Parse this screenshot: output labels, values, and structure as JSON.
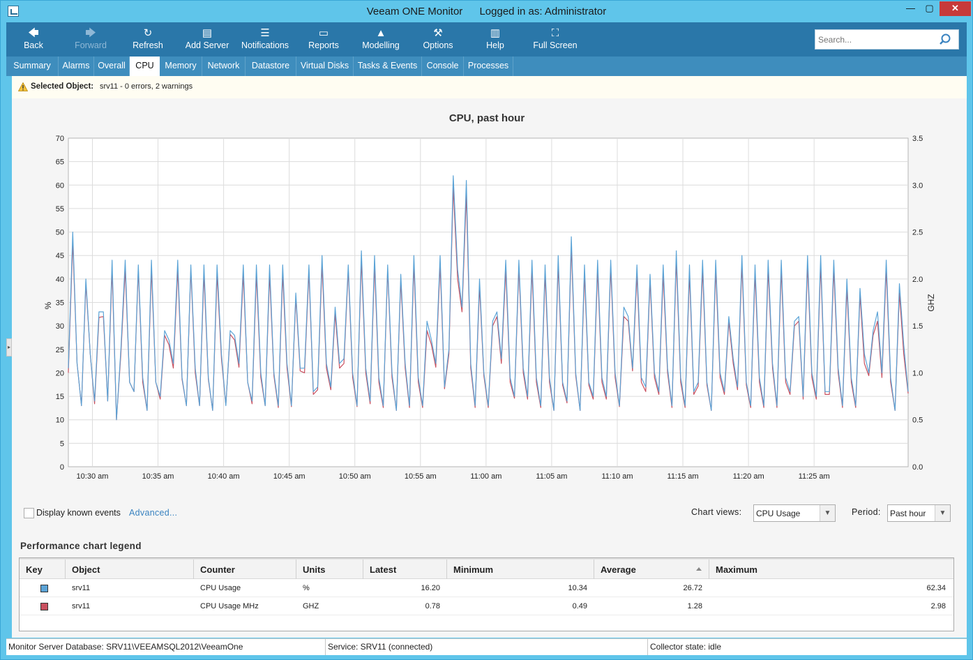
{
  "window": {
    "app_name": "Veeam ONE Monitor",
    "logged_in": "Logged in as: Administrator",
    "min_glyph": "—",
    "max_glyph": "▢",
    "close_glyph": "✕"
  },
  "toolbar": {
    "items": [
      {
        "label": "Back",
        "icon": "arrow-left-icon",
        "glyph": "🡄"
      },
      {
        "label": "Forward",
        "icon": "arrow-right-icon",
        "glyph": "🡆"
      },
      {
        "label": "Refresh",
        "icon": "refresh-icon",
        "glyph": "↻"
      },
      {
        "label": "Add Server",
        "icon": "add-server-icon",
        "glyph": "▤"
      },
      {
        "label": "Notifications",
        "icon": "notifications-icon",
        "glyph": "☰"
      },
      {
        "label": "Reports",
        "icon": "reports-icon",
        "glyph": "▭"
      },
      {
        "label": "Modelling",
        "icon": "modelling-icon",
        "glyph": "▲"
      },
      {
        "label": "Options",
        "icon": "wrench-icon",
        "glyph": "⚒"
      },
      {
        "label": "Help",
        "icon": "book-icon",
        "glyph": "▥"
      },
      {
        "label": "Full Screen",
        "icon": "fullscreen-icon",
        "glyph": "⛶"
      }
    ],
    "search_placeholder": "Search..."
  },
  "tabs": [
    {
      "label": "Summary"
    },
    {
      "label": "Alarms"
    },
    {
      "label": "Overall"
    },
    {
      "label": "CPU",
      "active": true
    },
    {
      "label": "Memory"
    },
    {
      "label": "Network"
    },
    {
      "label": "Datastore"
    },
    {
      "label": "Virtual Disks"
    },
    {
      "label": "Tasks & Events"
    },
    {
      "label": "Console"
    },
    {
      "label": "Processes"
    }
  ],
  "selected_object": {
    "label": "Selected Object:",
    "value": "srv11  - 0 errors, 2 warnings"
  },
  "chart_data": {
    "type": "line",
    "title": "CPU, past hour",
    "ylabel": "%",
    "y2label": "GHZ",
    "ylim": [
      0,
      70
    ],
    "y2lim": [
      0,
      3.5
    ],
    "yticks": [
      "0",
      "5",
      "10",
      "15",
      "20",
      "25",
      "30",
      "35",
      "40",
      "45",
      "50",
      "55",
      "60",
      "65",
      "70"
    ],
    "y2ticks": [
      "0.0",
      "0.5",
      "1.0",
      "1.5",
      "2.0",
      "2.5",
      "3.0",
      "3.5"
    ],
    "xticks": [
      "10:30 am",
      "10:35 am",
      "10:40 am",
      "10:45 am",
      "10:50 am",
      "10:55 am",
      "11:00 am",
      "11:05 am",
      "11:10 am",
      "11:15 am",
      "11:20 am",
      "11:25 am"
    ],
    "x_start": "10:28:10 am",
    "x_interval_seconds": 20,
    "colors": {
      "CPU Usage": "#5ba3d6",
      "CPU Usage MHz": "#c9505f"
    },
    "series": [
      {
        "name": "CPU Usage",
        "axis": "left",
        "values": [
          21,
          50,
          22,
          13,
          40,
          24,
          14,
          33,
          33,
          14,
          44,
          10,
          25,
          44,
          18,
          16,
          43,
          19,
          12,
          44,
          18,
          15,
          29,
          27,
          22,
          44,
          19,
          13,
          43,
          21,
          13,
          43,
          19,
          12,
          43,
          24,
          13,
          29,
          28,
          22,
          43,
          18,
          14,
          43,
          20,
          13,
          43,
          20,
          13,
          43,
          22,
          13,
          37,
          21,
          21,
          43,
          16,
          17,
          45,
          22,
          17,
          34,
          22,
          23,
          43,
          20,
          13,
          46,
          21,
          14,
          45,
          19,
          13,
          43,
          20,
          12,
          41,
          22,
          13,
          45,
          19,
          13,
          31,
          27,
          22,
          45,
          17,
          25,
          62,
          42,
          34,
          61,
          22,
          13,
          40,
          20,
          13,
          31,
          33,
          23,
          44,
          19,
          15,
          44,
          21,
          15,
          44,
          19,
          13,
          43,
          19,
          12,
          45,
          18,
          14,
          49,
          20,
          12,
          43,
          18,
          15,
          44,
          19,
          15,
          44,
          20,
          13,
          34,
          32,
          21,
          43,
          19,
          17,
          41,
          20,
          16,
          43,
          21,
          13,
          46,
          19,
          13,
          43,
          16,
          18,
          44,
          18,
          12,
          44,
          20,
          16,
          32,
          23,
          17,
          45,
          18,
          13,
          43,
          19,
          13,
          44,
          22,
          13,
          44,
          19,
          16,
          31,
          32,
          15,
          45,
          20,
          15,
          45,
          16,
          16,
          44,
          21,
          13,
          40,
          19,
          13,
          38,
          24,
          20,
          29,
          33,
          20,
          44,
          19,
          12,
          39,
          26,
          16
        ]
      },
      {
        "name": "CPU Usage MHz",
        "axis": "right",
        "values": [
          1.0,
          2.4,
          1.1,
          0.65,
          1.95,
          1.2,
          0.67,
          1.59,
          1.6,
          0.7,
          2.1,
          0.5,
          1.2,
          2.1,
          0.9,
          0.8,
          2.1,
          0.9,
          0.6,
          2.1,
          0.9,
          0.72,
          1.4,
          1.3,
          1.05,
          2.1,
          0.93,
          0.65,
          2.1,
          1.0,
          0.65,
          2.05,
          0.93,
          0.6,
          2.05,
          1.15,
          0.66,
          1.41,
          1.35,
          1.06,
          2.05,
          0.9,
          0.67,
          2.05,
          0.95,
          0.65,
          2.05,
          0.97,
          0.63,
          2.05,
          1.05,
          0.64,
          1.8,
          1.02,
          1.0,
          2.08,
          0.77,
          0.82,
          2.15,
          1.05,
          0.82,
          1.63,
          1.05,
          1.1,
          2.1,
          0.95,
          0.64,
          2.2,
          1.0,
          0.67,
          2.15,
          0.9,
          0.63,
          2.1,
          0.95,
          0.6,
          1.98,
          1.05,
          0.63,
          2.15,
          0.9,
          0.63,
          1.45,
          1.3,
          1.06,
          2.15,
          0.83,
          1.2,
          2.98,
          2.0,
          1.65,
          2.9,
          1.05,
          0.63,
          1.92,
          0.97,
          0.63,
          1.5,
          1.6,
          1.1,
          2.1,
          0.9,
          0.73,
          2.12,
          1.0,
          0.72,
          2.1,
          0.9,
          0.63,
          2.05,
          0.9,
          0.6,
          2.15,
          0.87,
          0.68,
          2.35,
          0.97,
          0.6,
          2.05,
          0.87,
          0.72,
          2.1,
          0.9,
          0.72,
          2.12,
          0.95,
          0.64,
          1.6,
          1.55,
          1.02,
          2.05,
          0.9,
          0.8,
          1.98,
          0.95,
          0.77,
          2.05,
          1.0,
          0.63,
          2.2,
          0.9,
          0.63,
          2.05,
          0.77,
          0.86,
          2.1,
          0.87,
          0.6,
          2.1,
          0.95,
          0.77,
          1.55,
          1.1,
          0.82,
          2.15,
          0.87,
          0.63,
          2.05,
          0.9,
          0.63,
          2.1,
          1.05,
          0.63,
          2.1,
          0.9,
          0.77,
          1.5,
          1.55,
          0.72,
          2.15,
          0.95,
          0.72,
          2.15,
          0.77,
          0.77,
          2.1,
          1.0,
          0.63,
          1.9,
          0.9,
          0.63,
          1.83,
          1.1,
          0.97,
          1.4,
          1.55,
          0.95,
          2.1,
          0.9,
          0.6,
          1.85,
          1.2,
          0.78
        ]
      }
    ]
  },
  "controls": {
    "display_events_label": "Display known events",
    "advanced_label": "Advanced...",
    "chart_views_label": "Chart views:",
    "chart_views_value": "CPU Usage",
    "period_label": "Period:",
    "period_value": "Past hour"
  },
  "legend": {
    "title": "Performance chart legend",
    "columns": [
      "Key",
      "Object",
      "Counter",
      "Units",
      "Latest",
      "Minimum",
      "Average",
      "Maximum"
    ],
    "rows": [
      {
        "color": "#5ba3d6",
        "object": "srv11",
        "counter": "CPU Usage",
        "units": "%",
        "latest": "16.20",
        "minimum": "10.34",
        "average": "26.72",
        "maximum": "62.34"
      },
      {
        "color": "#c9505f",
        "object": "srv11",
        "counter": "CPU Usage MHz",
        "units": "GHZ",
        "latest": "0.78",
        "minimum": "0.49",
        "average": "1.28",
        "maximum": "2.98"
      }
    ]
  },
  "status": {
    "database": "Monitor Server Database: SRV11\\VEEAMSQL2012\\VeeamOne",
    "service": "Service: SRV11 (connected)",
    "collector": "Collector state:  idle"
  }
}
